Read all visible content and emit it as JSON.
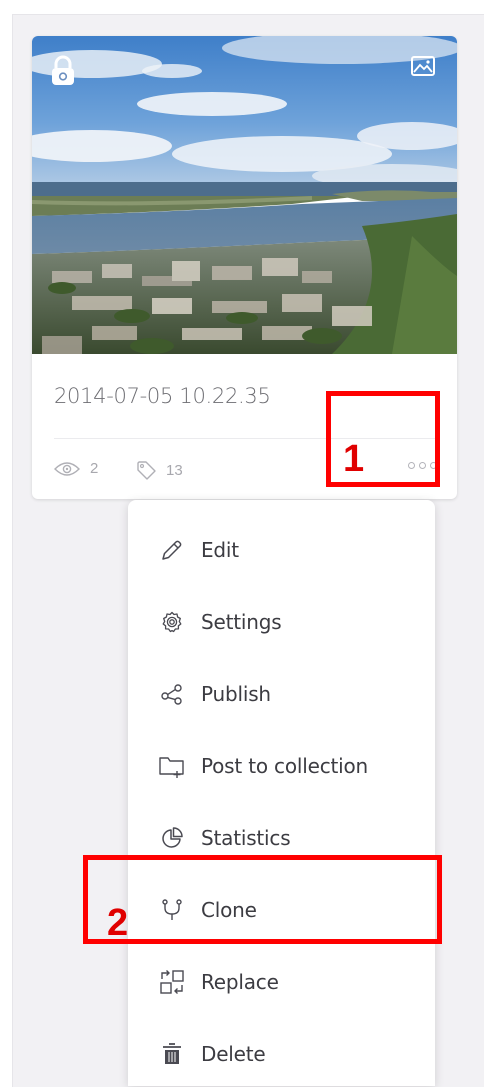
{
  "card": {
    "title": "2014-07-05 10.22.35",
    "views": "2",
    "tags": "13",
    "icons": {
      "lock": "lock-icon",
      "type": "image-icon",
      "views": "eye-icon",
      "tags": "tag-icon",
      "more": "more-dots-icon"
    }
  },
  "menu": {
    "items": [
      {
        "label": "Edit",
        "icon": "pencil-icon"
      },
      {
        "label": "Settings",
        "icon": "gear-icon"
      },
      {
        "label": "Publish",
        "icon": "share-icon"
      },
      {
        "label": "Post to collection",
        "icon": "folder-add-icon"
      },
      {
        "label": "Statistics",
        "icon": "pie-chart-icon"
      },
      {
        "label": "Clone",
        "icon": "clone-icon"
      },
      {
        "label": "Replace",
        "icon": "replace-icon"
      },
      {
        "label": "Delete",
        "icon": "trash-icon"
      }
    ]
  },
  "annotations": {
    "callout_1": "1",
    "callout_2": "2",
    "color": "#ff0000"
  },
  "colors": {
    "panel_bg": "#f2f1f4",
    "icon": "#4a4a52",
    "text": "#3c3c42",
    "muted": "#a8a8ae"
  }
}
